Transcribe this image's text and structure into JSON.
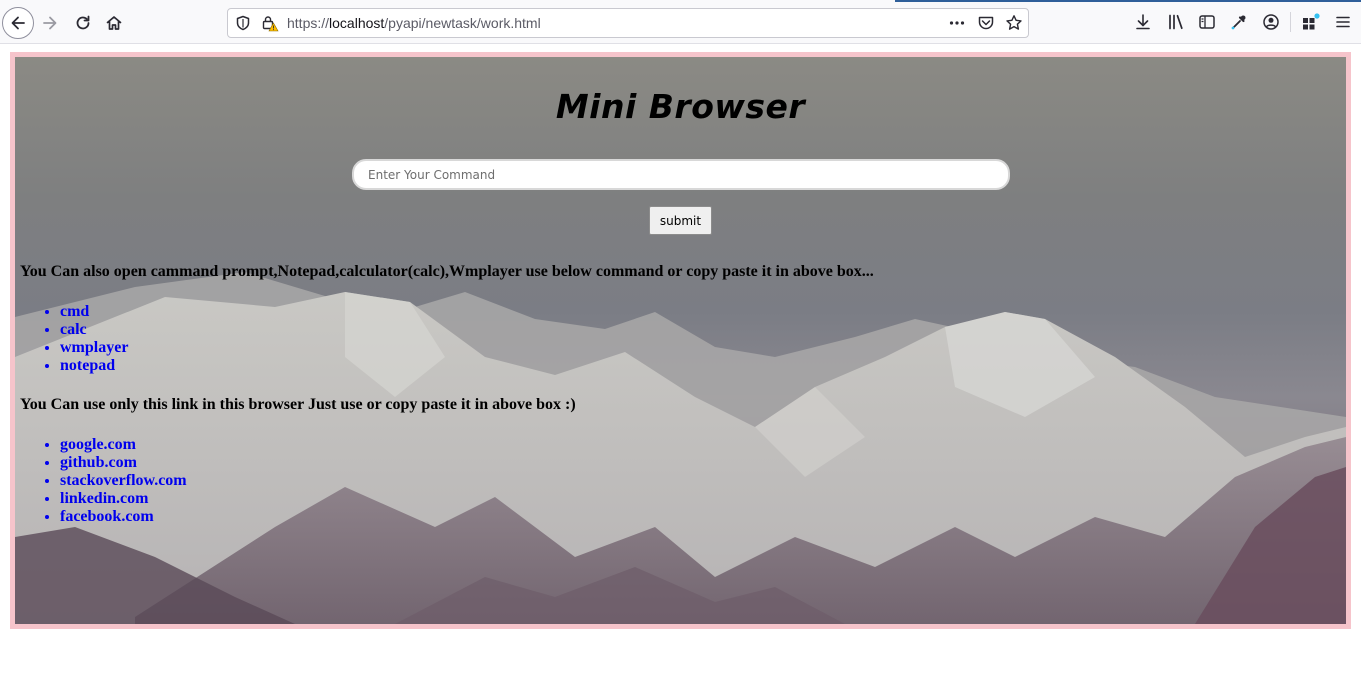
{
  "browser": {
    "url_scheme": "https://",
    "url_host": "localhost",
    "url_path": "/pyapi/newtask/work.html",
    "icons": {
      "back": "back-arrow-icon",
      "forward": "forward-arrow-icon",
      "reload": "reload-icon",
      "home": "home-icon",
      "shield": "shield-icon",
      "lock_warning": "lock-warning-icon",
      "more": "more-dots-icon",
      "pocket": "pocket-icon",
      "bookmark": "star-icon",
      "downloads": "download-icon",
      "library": "library-icon",
      "sidebar": "sidebar-icon",
      "eyedropper": "eyedropper-icon",
      "account": "account-icon",
      "extensions": "extensions-icon",
      "menu": "hamburger-menu-icon"
    }
  },
  "page": {
    "title": "Mini Browser",
    "command_placeholder": "Enter Your Command",
    "command_value": "",
    "submit_label": "submit",
    "commands_heading": "You Can also open cammand prompt,Notepad,calculator(calc),Wmplayer use below command or copy paste it in above box...",
    "commands": [
      "cmd",
      "calc",
      "wmplayer",
      "notepad"
    ],
    "links_heading": "You Can use only this link in this browser Just use or copy paste it in above box :)",
    "links": [
      "google.com",
      "github.com",
      "stackoverflow.com",
      "linkedin.com",
      "facebook.com"
    ],
    "colors": {
      "frame_border": "#f6c4cb",
      "link": "#0000ee",
      "text": "#000000"
    }
  }
}
